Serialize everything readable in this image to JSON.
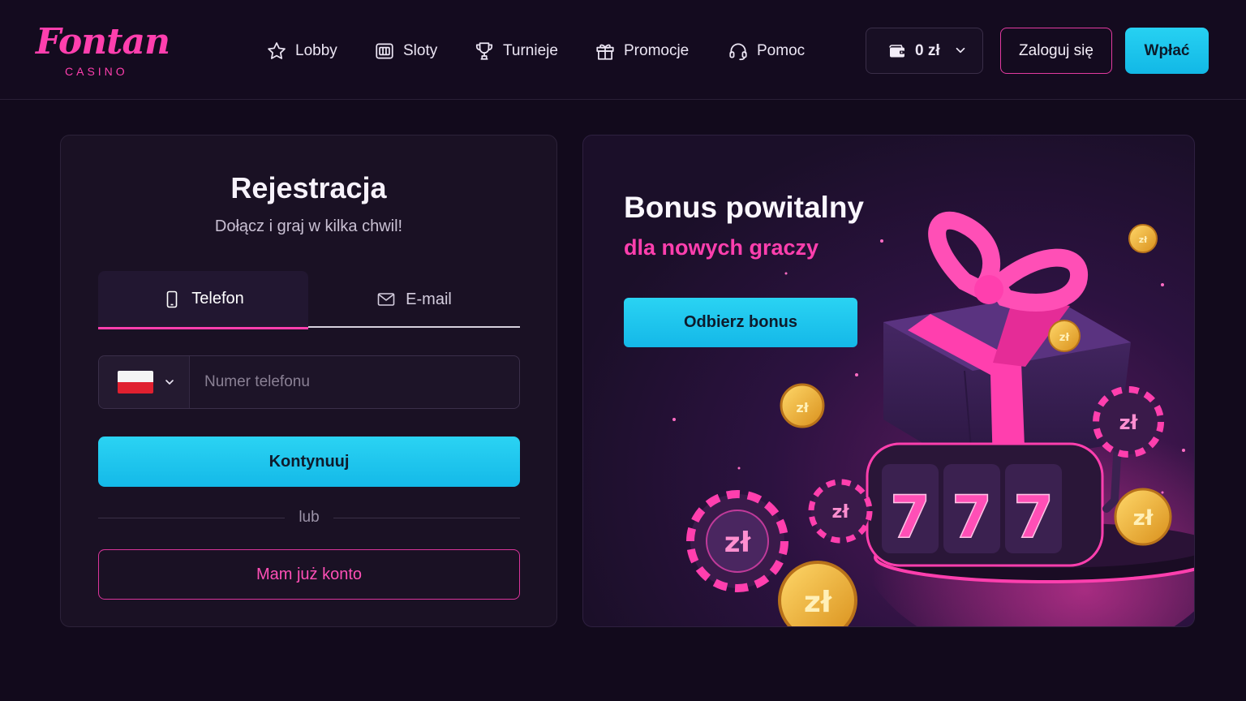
{
  "brand": {
    "name": "Fontan",
    "subtitle": "CASINO",
    "accent": "#ff3fae",
    "cta": "#1cc4ee"
  },
  "nav": [
    {
      "label": "Lobby",
      "icon": "star-icon"
    },
    {
      "label": "Sloty",
      "icon": "slot-machine-icon"
    },
    {
      "label": "Turnieje",
      "icon": "trophy-icon"
    },
    {
      "label": "Promocje",
      "icon": "gift-icon"
    },
    {
      "label": "Pomoc",
      "icon": "headset-icon"
    }
  ],
  "wallet": {
    "balance": "0 zł",
    "icon": "wallet-icon"
  },
  "header_buttons": {
    "login": "Zaloguj się",
    "deposit": "Wpłać"
  },
  "register": {
    "title": "Rejestracja",
    "subtitle": "Dołącz i graj w kilka chwil!",
    "tabs": [
      {
        "label": "Telefon",
        "icon": "phone-icon",
        "active": true
      },
      {
        "label": "E-mail",
        "icon": "mail-icon",
        "active": false
      }
    ],
    "country_flag": "poland-flag",
    "phone_placeholder": "Numer telefonu",
    "phone_value": "",
    "continue": "Kontynuuj",
    "or": "lub",
    "have_account": "Mam już konto"
  },
  "bonus": {
    "title": "Bonus powitalny",
    "subtitle": "dla nowych graczy",
    "cta": "Odbierz bonus",
    "art": {
      "reel_symbols": [
        "7",
        "7",
        "7"
      ],
      "coin_symbol": "zł"
    }
  }
}
